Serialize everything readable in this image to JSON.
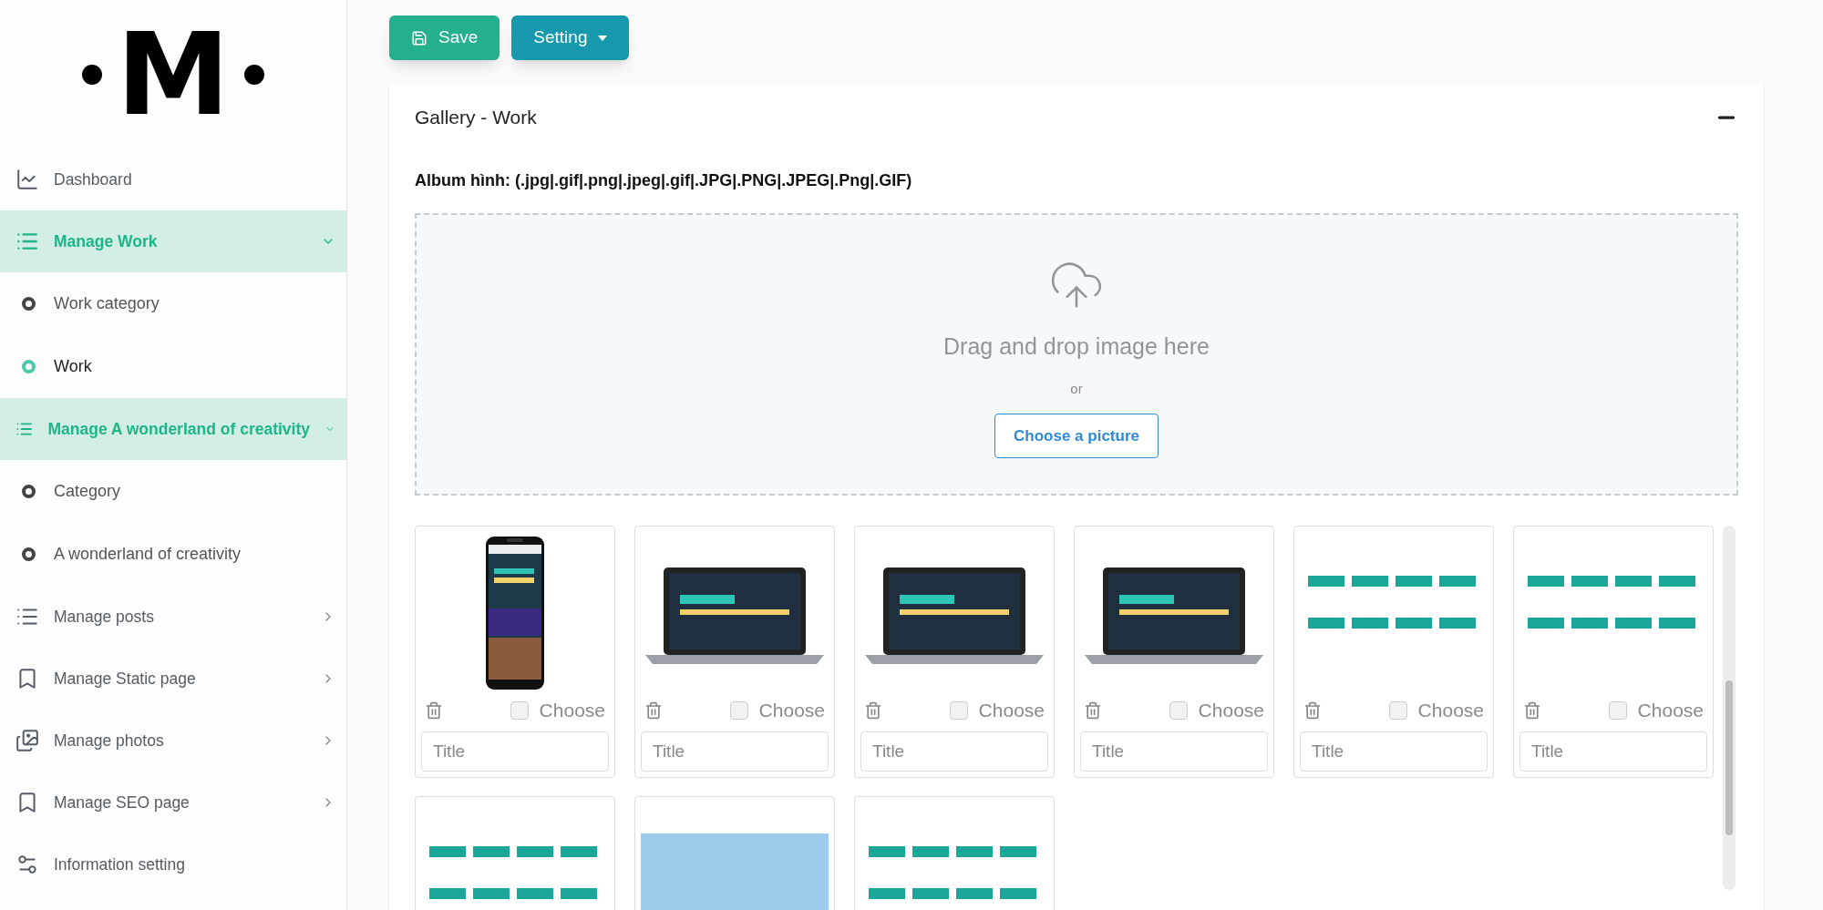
{
  "logo": {
    "text": "M"
  },
  "sidebar": {
    "items": [
      {
        "kind": "link",
        "label": "Dashboard",
        "selected": false
      },
      {
        "kind": "group",
        "label": "Manage Work",
        "selected": true,
        "expanded": true,
        "children": [
          {
            "label": "Work category",
            "selected": false
          },
          {
            "label": "Work",
            "selected": true
          }
        ]
      },
      {
        "kind": "group",
        "label": "Manage A wonderland of creativity",
        "selected": true,
        "expanded": true,
        "children": [
          {
            "label": "Category",
            "selected": false
          },
          {
            "label": "A wonderland of creativity",
            "selected": false
          }
        ]
      },
      {
        "kind": "group",
        "label": "Manage posts",
        "selected": false,
        "expanded": false
      },
      {
        "kind": "group",
        "label": "Manage Static page",
        "selected": false,
        "expanded": false
      },
      {
        "kind": "group",
        "label": "Manage photos",
        "selected": false,
        "expanded": false
      },
      {
        "kind": "group",
        "label": "Manage SEO page",
        "selected": false,
        "expanded": false
      },
      {
        "kind": "link",
        "label": "Information setting",
        "selected": false
      }
    ]
  },
  "toolbar": {
    "save": "Save",
    "setting": "Setting"
  },
  "card": {
    "title": "Gallery - Work",
    "expanded": true,
    "formats": "Album hình: (.jpg|.gif|.png|.jpeg|.gif|.JPG|.PNG|.JPEG|.Png|.GIF)",
    "dropzone": {
      "text": "Drag and drop image here",
      "or": "or",
      "button": "Choose a picture"
    },
    "tiles": [
      {
        "kind": "phone",
        "choose": "Choose",
        "checked": false,
        "title_placeholder": "Title"
      },
      {
        "kind": "laptop",
        "choose": "Choose",
        "checked": false,
        "title_placeholder": "Title"
      },
      {
        "kind": "laptop",
        "choose": "Choose",
        "checked": false,
        "title_placeholder": "Title"
      },
      {
        "kind": "laptop",
        "choose": "Choose",
        "checked": false,
        "title_placeholder": "Title"
      },
      {
        "kind": "screenshot",
        "choose": "Choose",
        "checked": false,
        "title_placeholder": "Title"
      },
      {
        "kind": "screenshot",
        "choose": "Choose",
        "checked": false,
        "title_placeholder": "Title"
      },
      {
        "kind": "screenshot"
      },
      {
        "kind": "photo"
      },
      {
        "kind": "screenshot"
      }
    ]
  }
}
